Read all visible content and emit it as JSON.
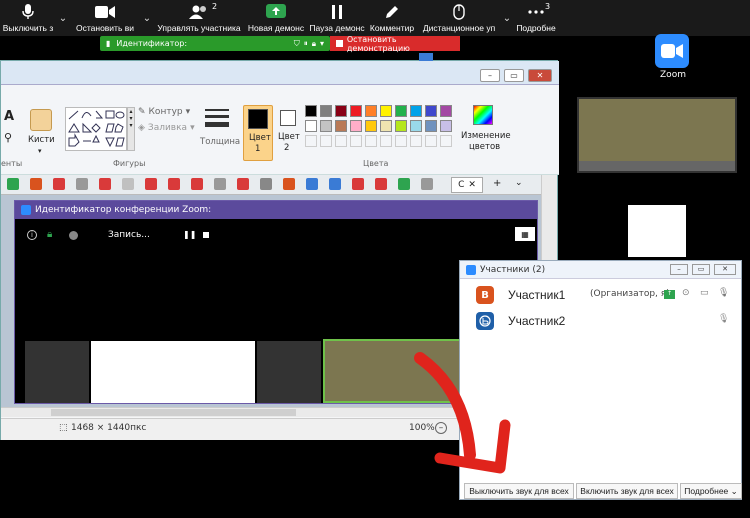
{
  "toolbar": {
    "mute": "Выключить з",
    "stop_video": "Остановить ви",
    "participants": "Управлять участника",
    "participants_count": "2",
    "new_share": "Новая демонс",
    "pause_share": "Пауза демонс",
    "annotate": "Комментир",
    "remote_control": "Дистанционное уп",
    "more": "Подробне",
    "more_count": "3"
  },
  "share_bar": {
    "id_label": "Идентификатор:",
    "stop_label": "Остановить демонстрацию"
  },
  "desktop": {
    "zoom_icon_label": "Zoom"
  },
  "paint": {
    "brushes": "Кисти",
    "shapes_group": "Фигуры",
    "outline": "Контур",
    "fill": "Заливка",
    "thickness": "Толщина",
    "color1": "Цвет 1",
    "color1_a": "Цвет",
    "color1_b": "1",
    "color2_a": "Цвет",
    "color2_b": "2",
    "colors_group": "Цвета",
    "edit_colors_a": "Изменение",
    "edit_colors_b": "цветов",
    "tools_partial": "енты",
    "status_size": "1468 × 1440пкс",
    "zoom_level": "100%",
    "palette": [
      "#000000",
      "#7f7f7f",
      "#880015",
      "#ed1c24",
      "#ff7f27",
      "#fff200",
      "#22b14c",
      "#00a2e8",
      "#3f48cc",
      "#a349a4",
      "#ffffff",
      "#c3c3c3",
      "#b97a57",
      "#ffaec9",
      "#ffc90e",
      "#efe4b0",
      "#b5e61d",
      "#99d9ea",
      "#7092be",
      "#c8bfe7"
    ]
  },
  "meeting": {
    "title": "Идентификатор конференции Zoom:",
    "recording": "Запись..."
  },
  "participants_panel": {
    "title": "Участники (2)",
    "rows": [
      {
        "initial": "В",
        "name": "Участник1",
        "role": "(Организатор, я)",
        "color": "#d9531e"
      },
      {
        "initial": "",
        "name": "Участник2",
        "role": "",
        "color": "#1f5fa8"
      }
    ],
    "mute_all": "Выключить звук для всех",
    "unmute_all": "Включить звук для всех",
    "more": "Подробнее"
  }
}
